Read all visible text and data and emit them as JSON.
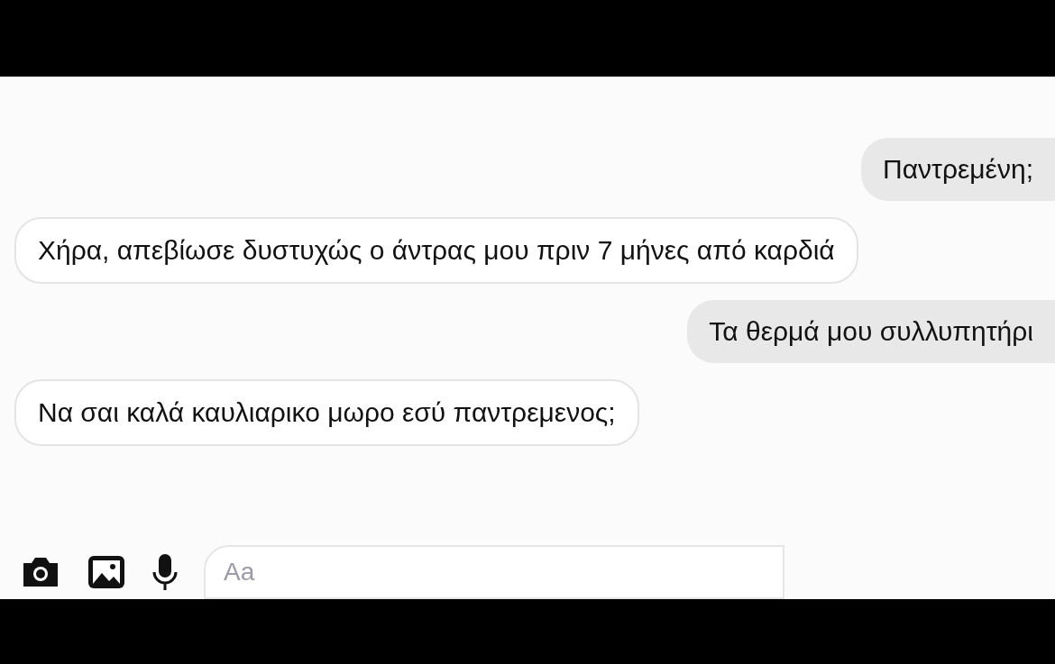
{
  "messages": [
    {
      "text": "Παντρεμένη;",
      "kind": "outgoing"
    },
    {
      "text": "Χήρα, απεβίωσε δυστυχώς  ο άντρας μου πριν 7 μήνες από καρδιά",
      "kind": "incoming"
    },
    {
      "text": "Τα θερμά μου συλλυπητήρι",
      "kind": "outgoing"
    },
    {
      "text": "Να σαι καλά καυλιαρικο μωρο εσύ παντρεμενος;",
      "kind": "incoming"
    }
  ],
  "composer": {
    "placeholder": "Aa"
  }
}
